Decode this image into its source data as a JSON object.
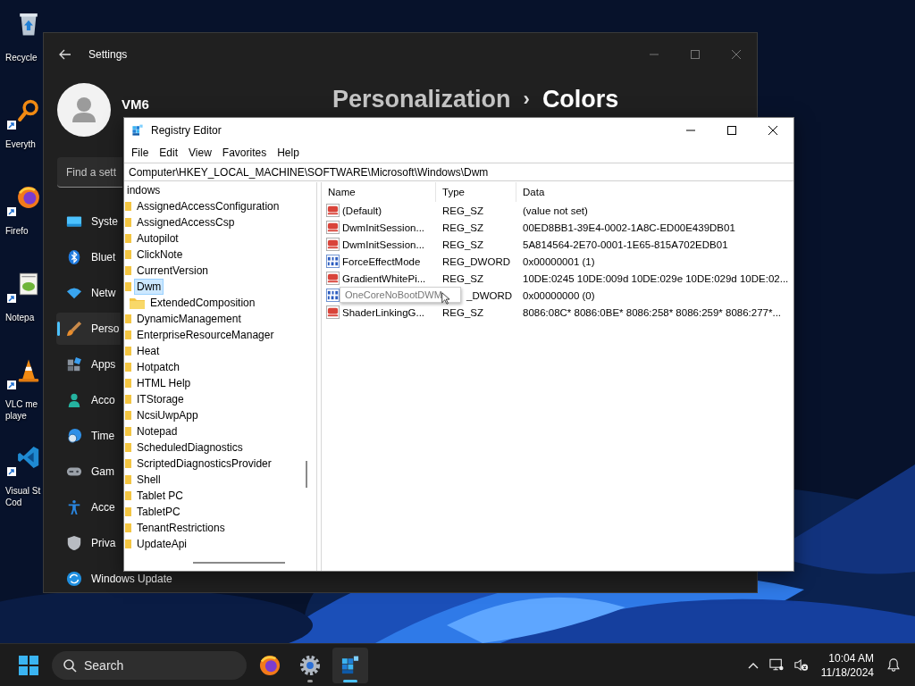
{
  "desktop_icons": [
    {
      "lines": [
        "Recycle"
      ],
      "shortcut": false
    },
    {
      "lines": [
        "Everyth"
      ],
      "shortcut": true
    },
    {
      "lines": [
        "Firefo"
      ],
      "shortcut": true
    },
    {
      "lines": [
        "Notepa"
      ],
      "shortcut": true
    },
    {
      "lines": [
        "VLC me",
        "playe"
      ],
      "shortcut": true
    },
    {
      "lines": [
        "Visual St",
        "Cod"
      ],
      "shortcut": true
    }
  ],
  "settings": {
    "title": "Settings",
    "user": {
      "name": "VM6"
    },
    "search": {
      "placeholder": "Find a sett"
    },
    "breadcrumb": {
      "parent": "Personalization",
      "separator": "›",
      "current": "Colors"
    },
    "nav": [
      {
        "label": "Syste",
        "selected": false
      },
      {
        "label": "Bluet",
        "selected": false
      },
      {
        "label": "Netw",
        "selected": false
      },
      {
        "label": "Perso",
        "selected": true
      },
      {
        "label": "Apps",
        "selected": false
      },
      {
        "label": "Acco",
        "selected": false
      },
      {
        "label": "Time",
        "selected": false
      },
      {
        "label": "Gam",
        "selected": false
      },
      {
        "label": "Acce",
        "selected": false
      },
      {
        "label": "Priva",
        "selected": false
      },
      {
        "label": "Windows Update",
        "selected": false
      }
    ]
  },
  "registry": {
    "title": "Registry Editor",
    "menu": [
      "File",
      "Edit",
      "View",
      "Favorites",
      "Help"
    ],
    "address": "Computer\\HKEY_LOCAL_MACHINE\\SOFTWARE\\Microsoft\\Windows\\Dwm",
    "tree": {
      "label": "indows",
      "children": [
        {
          "label": "AssignedAccessConfiguration",
          "selected": false
        },
        {
          "label": "AssignedAccessCsp",
          "selected": false
        },
        {
          "label": "Autopilot",
          "selected": false
        },
        {
          "label": "ClickNote",
          "selected": false
        },
        {
          "label": "CurrentVersion",
          "selected": false
        },
        {
          "label": "Dwm",
          "selected": true,
          "children": [
            {
              "label": "ExtendedComposition",
              "selected": false
            }
          ]
        },
        {
          "label": "DynamicManagement",
          "selected": false
        },
        {
          "label": "EnterpriseResourceManager",
          "selected": false
        },
        {
          "label": "Heat",
          "selected": false
        },
        {
          "label": "Hotpatch",
          "selected": false
        },
        {
          "label": "HTML Help",
          "selected": false
        },
        {
          "label": "ITStorage",
          "selected": false
        },
        {
          "label": "NcsiUwpApp",
          "selected": false
        },
        {
          "label": "Notepad",
          "selected": false
        },
        {
          "label": "ScheduledDiagnostics",
          "selected": false
        },
        {
          "label": "ScriptedDiagnosticsProvider",
          "selected": false
        },
        {
          "label": "Shell",
          "selected": false
        },
        {
          "label": "Tablet PC",
          "selected": false
        },
        {
          "label": "TabletPC",
          "selected": false
        },
        {
          "label": "TenantRestrictions",
          "selected": false
        },
        {
          "label": "UpdateApi",
          "selected": false
        }
      ]
    },
    "columns": [
      "Name",
      "Type",
      "Data"
    ],
    "values": [
      {
        "kind": "string",
        "name": "(Default)",
        "type": "REG_SZ",
        "data": "(value not set)",
        "tooltip": false
      },
      {
        "kind": "string",
        "name": "DwmInitSession...",
        "type": "REG_SZ",
        "data": "00ED8BB1-39E4-0002-1A8C-ED00E439DB01",
        "tooltip": false
      },
      {
        "kind": "string",
        "name": "DwmInitSession...",
        "type": "REG_SZ",
        "data": "5A814564-2E70-0001-1E65-815A702EDB01",
        "tooltip": false
      },
      {
        "kind": "dword",
        "name": "ForceEffectMode",
        "type": "REG_DWORD",
        "data": "0x00000001 (1)",
        "tooltip": false
      },
      {
        "kind": "string",
        "name": "GradientWhitePi...",
        "type": "REG_SZ",
        "data": "10DE:0245 10DE:009d 10DE:029e 10DE:029d 10DE:02...",
        "tooltip": false
      },
      {
        "kind": "dword",
        "name": "OneCoreNoBootDWM",
        "type": "_DWORD",
        "data": "0x00000000 (0)",
        "tooltip": true
      },
      {
        "kind": "string",
        "name": "ShaderLinkingG...",
        "type": "REG_SZ",
        "data": "8086:08C* 8086:0BE* 8086:258* 8086:259* 8086:277*...",
        "tooltip": false
      }
    ]
  },
  "taskbar": {
    "search": {
      "placeholder": "Search"
    },
    "apps": [
      {
        "open": false,
        "selected": false
      },
      {
        "open": true,
        "selected": false
      },
      {
        "open": true,
        "selected": true
      }
    ],
    "time": "10:04 AM",
    "date": "11/18/2024"
  }
}
